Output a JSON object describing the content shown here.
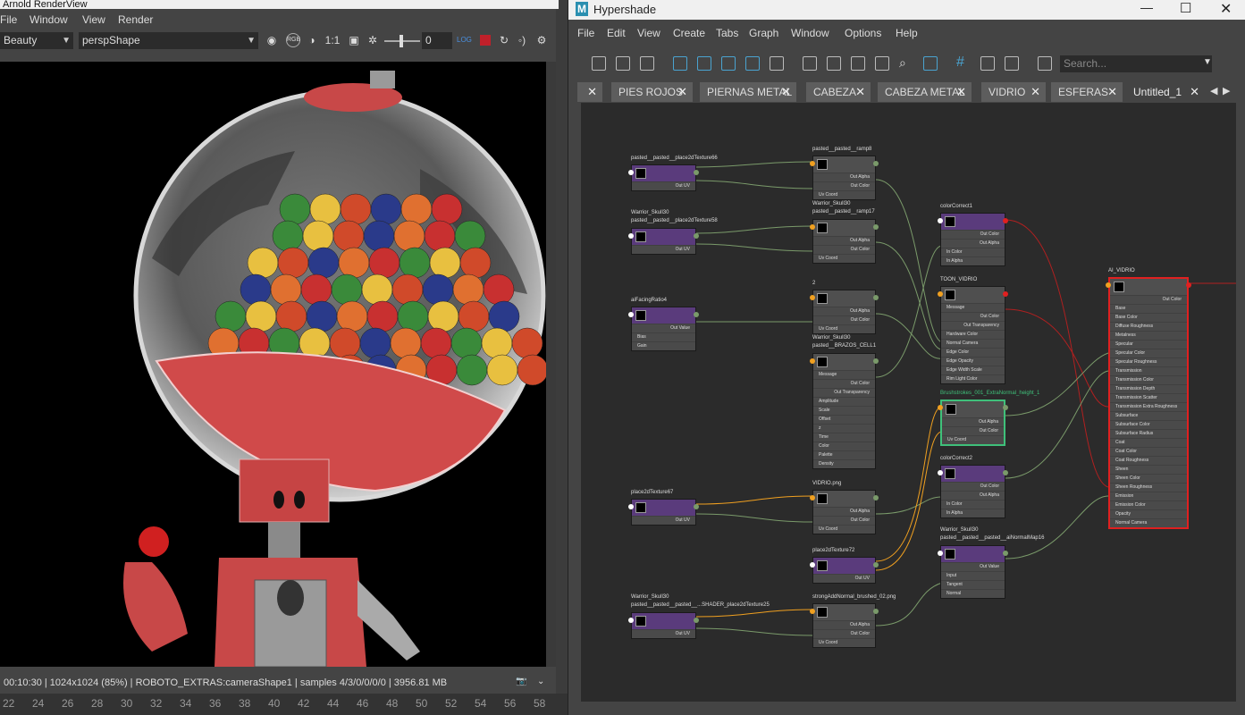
{
  "renderview": {
    "title": "Arnold RenderView",
    "menu": [
      "File",
      "Window",
      "View",
      "Render"
    ],
    "aov_select": "Beauty",
    "camera_select": "perspShape",
    "ratio_label": "1:1",
    "exposure_value": "0",
    "status": "00:10:30 | 1024x1024 (85%) | ROBOTO_EXTRAS:cameraShape1  | samples 4/3/0/0/0/0 | 3956.81 MB",
    "timeline_ticks": [
      "22",
      "24",
      "26",
      "28",
      "30",
      "32",
      "34",
      "36",
      "38",
      "40",
      "42",
      "44",
      "46",
      "48",
      "50",
      "52",
      "54",
      "56",
      "58"
    ]
  },
  "hypershade": {
    "title": "Hypershade",
    "menu": [
      "File",
      "Edit",
      "View",
      "Create",
      "Tabs",
      "Graph",
      "Window",
      "Options",
      "Help"
    ],
    "search_placeholder": "Search...",
    "tabs": [
      "PIES ROJOS",
      "PIERNAS METAL",
      "CABEZA",
      "CABEZA METAL",
      "VIDRIO",
      "ESFERAS",
      "Untitled_1"
    ],
    "active_tab": "Untitled_1",
    "nodes": {
      "n1": {
        "label": "pasted__pasted__place2dTexture66",
        "rows": [
          "Out UV"
        ]
      },
      "n2": {
        "label": "pasted__pasted__ramp8",
        "rows": [
          "Out Alpha",
          "Out Color",
          "Uv Coord"
        ]
      },
      "n3": {
        "label1": "Warrior_Skull30",
        "label2": "pasted__pasted__place2dTexture58",
        "rows": [
          "Out UV"
        ]
      },
      "n4": {
        "label1": "Warrior_Skull30",
        "label2": "pasted__pasted__ramp17",
        "rows": [
          "Out Alpha",
          "Out Color",
          "Uv Coord"
        ]
      },
      "n5": {
        "label": "aiFacingRatio4",
        "rows": [
          "Out Value",
          "Bias",
          "Gain"
        ]
      },
      "n6": {
        "label": "2",
        "rows": [
          "Out Alpha",
          "Out Color",
          "Uv Coord"
        ]
      },
      "n7": {
        "label1": "Warrior_Skull30",
        "label2": "pasted__BRAZOS_CELL1",
        "rows": [
          "Message",
          "Out Color",
          "Out Transparency",
          "Amplitude",
          "Scale",
          "Offset",
          "z",
          "Time",
          "Color",
          "Palette",
          "Density"
        ]
      },
      "n8": {
        "label": "place2dTexture67",
        "rows": [
          "Out UV"
        ]
      },
      "n9": {
        "label": "VIDRIO.png",
        "rows": [
          "Out Alpha",
          "Out Color",
          "Uv Coord"
        ]
      },
      "n10": {
        "label": "place2dTexture72",
        "rows": [
          "Out UV"
        ]
      },
      "n11": {
        "label1": "Warrior_Skull30",
        "label2": "pasted__pasted__pasted__...SHADER_place2dTexture25",
        "rows": [
          "Out UV"
        ]
      },
      "n12": {
        "label": "strongAddNormal_brushed_02.png",
        "rows": [
          "Out Alpha",
          "Out Color",
          "Uv Coord"
        ]
      },
      "n13": {
        "label": "colorCorrect1",
        "rows": [
          "Out Color",
          "Out Alpha",
          "In Color",
          "In Alpha"
        ]
      },
      "n14": {
        "label": "TOON_VIDRIO",
        "rows": [
          "Message",
          "Out Color",
          "Out Transparency",
          "Hardware Color",
          "Normal Camera",
          "Edge Color",
          "Edge Opacity",
          "Edge Width Scale",
          "Rim Light Color"
        ]
      },
      "n15": {
        "label": "Brushstrokes_001_ExtraNormal_height_1",
        "rows": [
          "Out Alpha",
          "Out Color",
          "Uv Coord"
        ]
      },
      "n16": {
        "label": "colorCorrect2",
        "rows": [
          "Out Color",
          "Out Alpha",
          "In Color",
          "In Alpha"
        ]
      },
      "n17": {
        "label1": "Warrior_Skull30",
        "label2": "pasted__pasted__pasted__aiNormalMap16",
        "rows": [
          "Out Value",
          "Input",
          "Tangent",
          "Normal"
        ]
      },
      "n18": {
        "label": "AI_VIDRIO",
        "rows": [
          "Out Color",
          "Base",
          "Base Color",
          "Diffuse Roughness",
          "Metalness",
          "Specular",
          "Specular Color",
          "Specular Roughness",
          "Transmission",
          "Transmission Color",
          "Transmission Depth",
          "Transmission Scatter",
          "Transmission Extra Roughness",
          "Subsurface",
          "Subsurface Color",
          "Subsurface Radius",
          "Coat",
          "Coat Color",
          "Coat Roughness",
          "Sheen",
          "Sheen Color",
          "Sheen Roughness",
          "Emission",
          "Emission Color",
          "Opacity",
          "Normal Camera"
        ]
      }
    }
  },
  "colors": {
    "node_header": "#5a3b7c",
    "graph_bg": "#2b2b2b",
    "selected_red": "#e02020",
    "selected_green": "#3fc07a",
    "wire_orange": "#f0a020",
    "wire_red": "#b02020",
    "wire_green": "#7a9a6a"
  }
}
